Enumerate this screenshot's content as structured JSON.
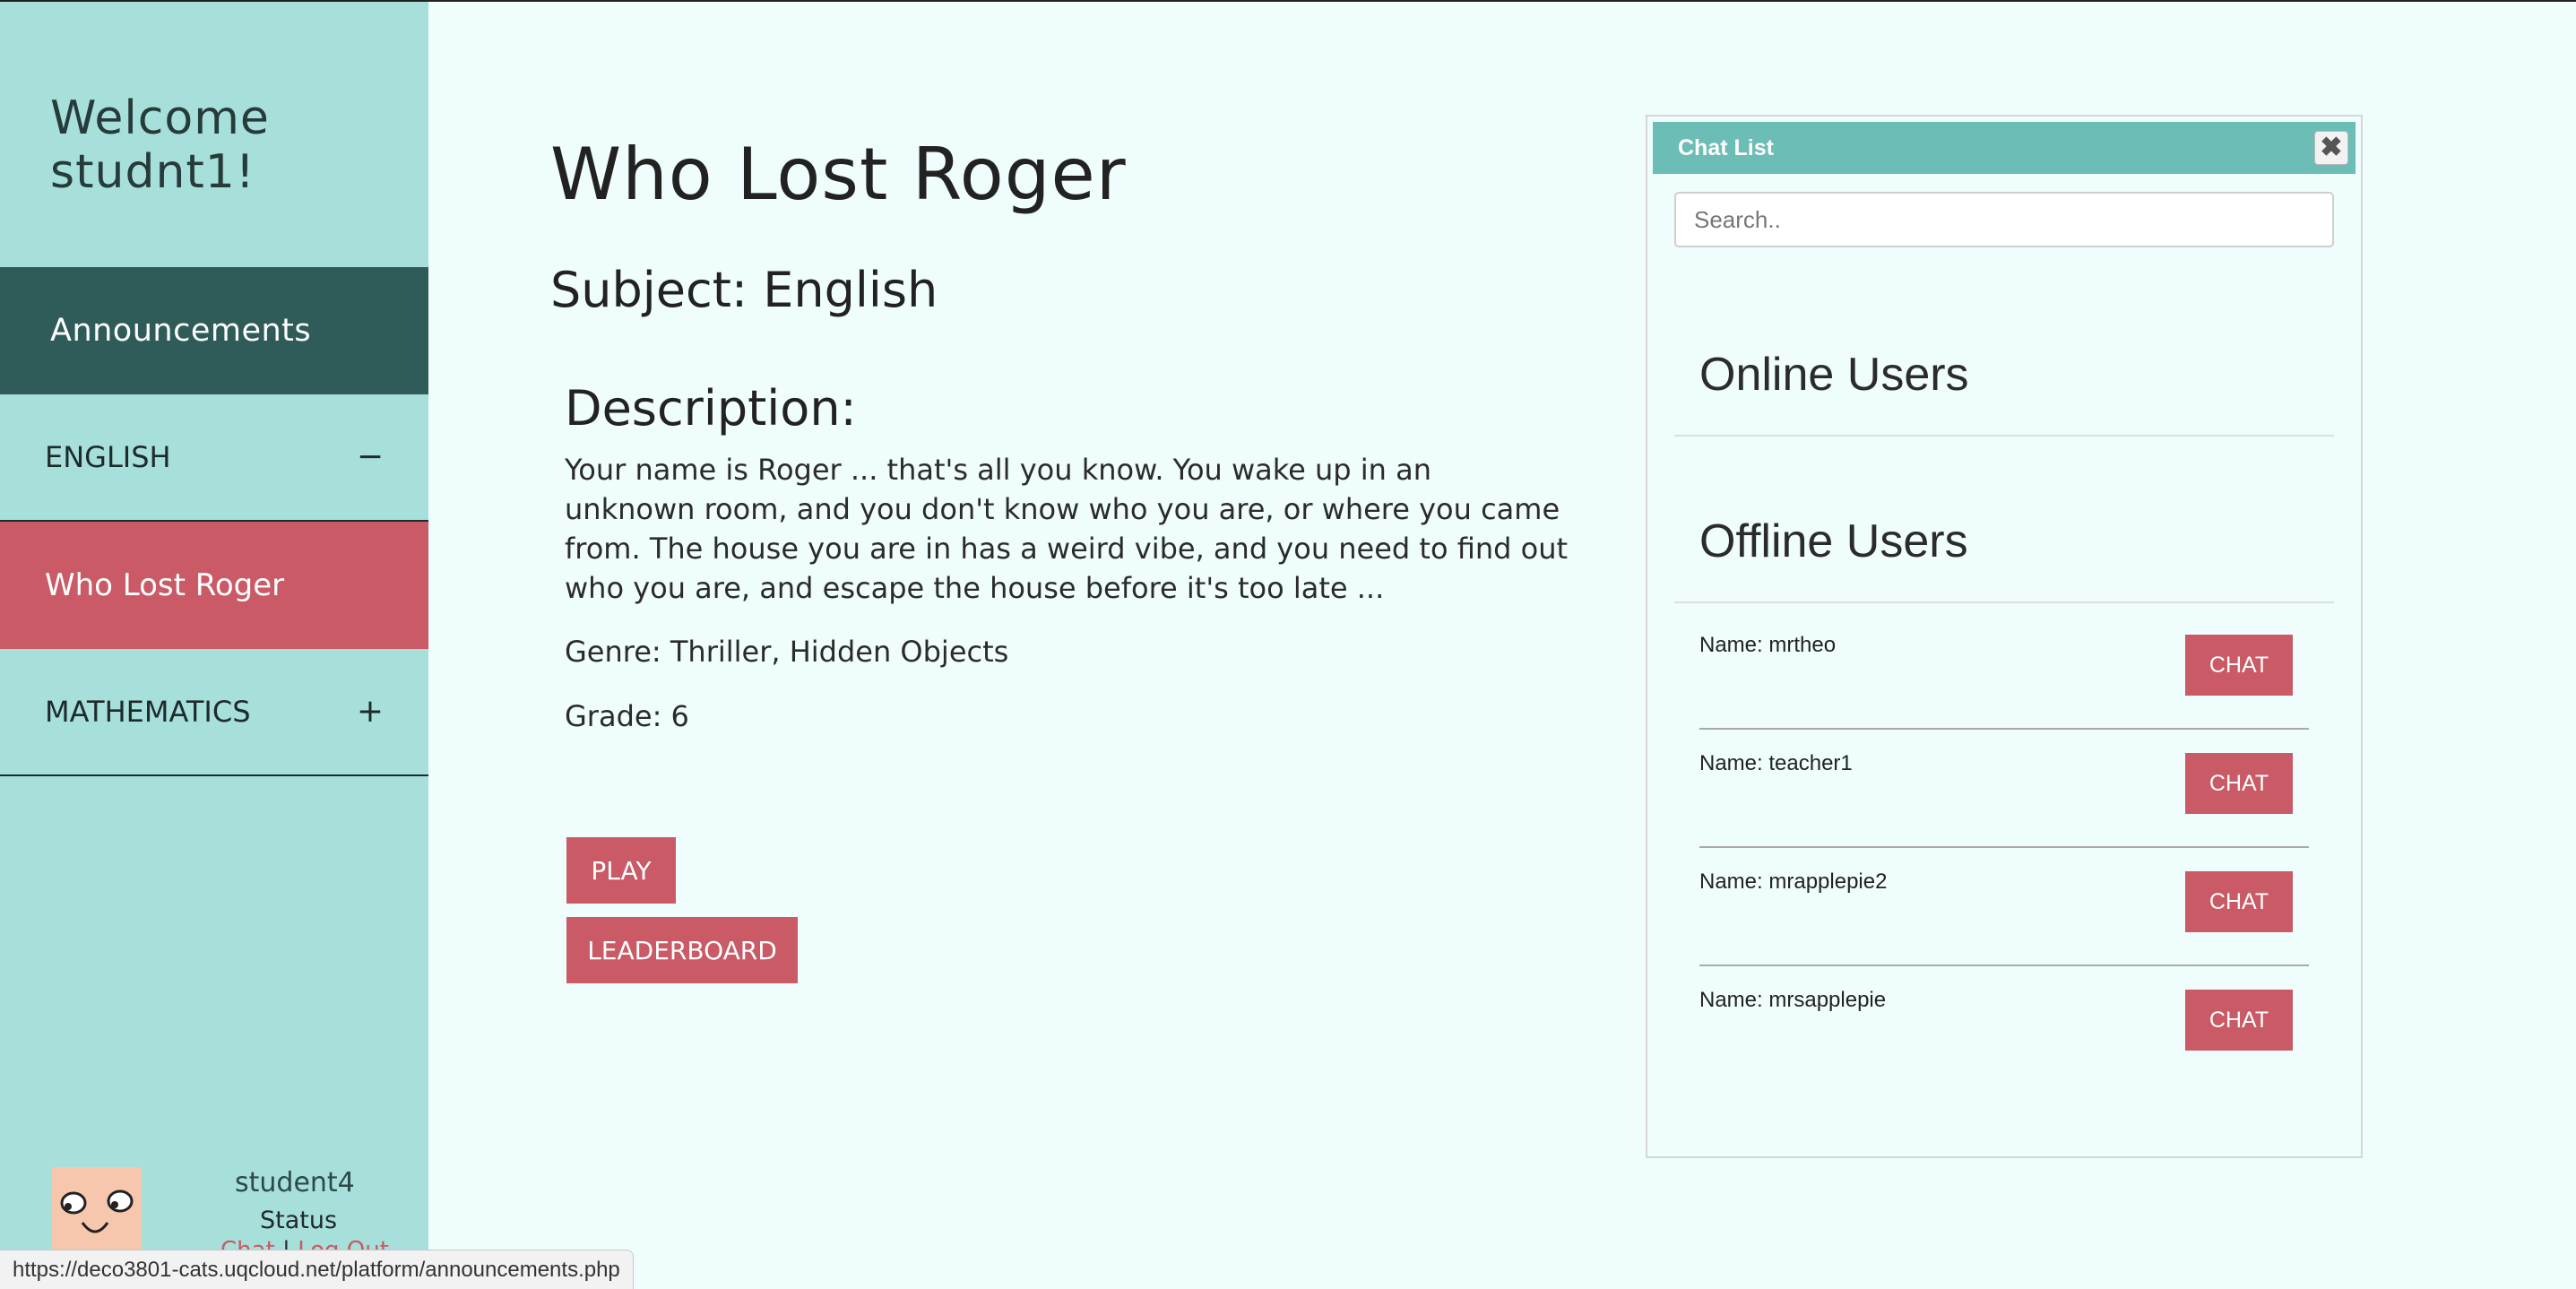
{
  "sidebar": {
    "welcome": "Welcome studnt1!",
    "announcements": "Announcements",
    "english": {
      "label": "ENGLISH",
      "toggle": "−"
    },
    "active_game": "Who Lost Roger",
    "mathematics": {
      "label": "MATHEMATICS",
      "toggle": "+"
    },
    "profile": {
      "username": "student4",
      "status": "Status",
      "chat_link": "Chat",
      "separator": "|",
      "logout_link": "Log Out"
    }
  },
  "main": {
    "title": "Who Lost Roger",
    "subject": "Subject: English",
    "description_heading": "Description:",
    "description": "Your name is Roger ... that's all you know. You wake up in an unknown room, and you don't know who you are, or where you came from. The house you are in has a weird vibe, and you need to find out who you are, and escape the house before it's too late ...",
    "genre": "Genre: Thriller, Hidden Objects",
    "grade": "Grade: 6",
    "play_label": "PLAY",
    "leaderboard_label": "LEADERBOARD"
  },
  "chat": {
    "title": "Chat List",
    "close": "✖",
    "search_placeholder": "Search..",
    "online_heading": "Online Users",
    "offline_heading": "Offline Users",
    "users": [
      {
        "name": "Name: mrtheo",
        "button": "CHAT"
      },
      {
        "name": "Name: teacher1",
        "button": "CHAT"
      },
      {
        "name": "Name: mrapplepie2",
        "button": "CHAT"
      },
      {
        "name": "Name: mrsapplepie",
        "button": "CHAT"
      }
    ]
  },
  "status_bar": {
    "url": "https://deco3801-cats.uqcloud.net/platform/announcements.php"
  },
  "colors": {
    "sidebar_bg": "#a7dfda",
    "announce_bg": "#2f5c58",
    "accent_red": "#c95a66",
    "chat_header": "#6cbdb5",
    "page_bg": "#effdfc"
  }
}
